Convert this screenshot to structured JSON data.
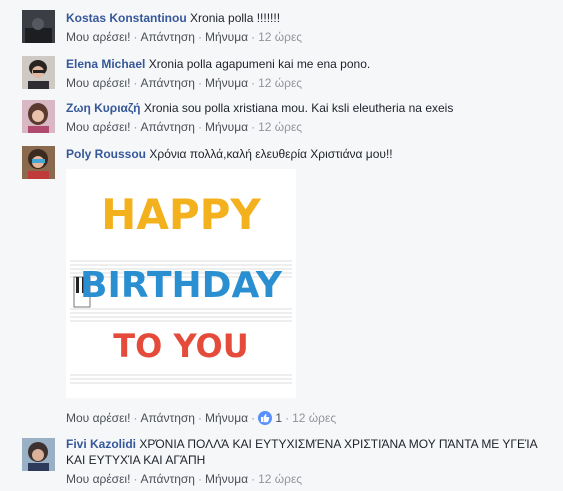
{
  "comments": [
    {
      "author": "Kostas Konstantinou",
      "text": "Xronia polla !!!!!!!",
      "like": "Μου αρέσει!",
      "reply": "Απάντηση",
      "message": "Μήνυμα",
      "time": "12 ώρες"
    },
    {
      "author": "Elena Michael",
      "text": "Xronia polla agapumeni kai me ena pono.",
      "like": "Μου αρέσει!",
      "reply": "Απάντηση",
      "message": "Μήνυμα",
      "time": "12 ώρες"
    },
    {
      "author": "Ζωη Κυριαζή",
      "text": "Xronia sou polla xristiana mou. Kai ksli eleutheria na exeis",
      "like": "Μου αρέσει!",
      "reply": "Απάντηση",
      "message": "Μήνυμα",
      "time": "12 ώρες"
    },
    {
      "author": "Poly Roussou",
      "text": "Χρόνια πολλά,καλή ελευθερία Χριστιάνα μου!!",
      "like": "Μου αρέσει!",
      "reply": "Απάντηση",
      "message": "Μήνυμα",
      "reaction_count": "1",
      "time": "12 ώρες",
      "image": {
        "line1": "HAPPY",
        "line2": "BIRTHDAY",
        "line3": "TO YOU"
      }
    },
    {
      "author": "Fivi Kazolidi",
      "text": "ΧΡΌΝΙΑ ΠΟΛΛΆ ΚΑΙ ΕΥΤΥΧΙΣΜΈΝΑ ΧΡΙΣΤΙΆΝΑ ΜΟΥ ΠΆΝΤΑ ΜΕ ΥΓΕΊΑ ΚΑΙ ΕΥΤΥΧΊΑ ΚΑΙ ΑΓΆΠΗ",
      "like": "Μου αρέσει!",
      "reply": "Απάντηση",
      "message": "Μήνυμα",
      "time": "12 ώρες"
    }
  ],
  "colors": {
    "author": "#365899",
    "text": "#1d2129",
    "meta": "#90949c",
    "like_badge": "#5890ff"
  }
}
